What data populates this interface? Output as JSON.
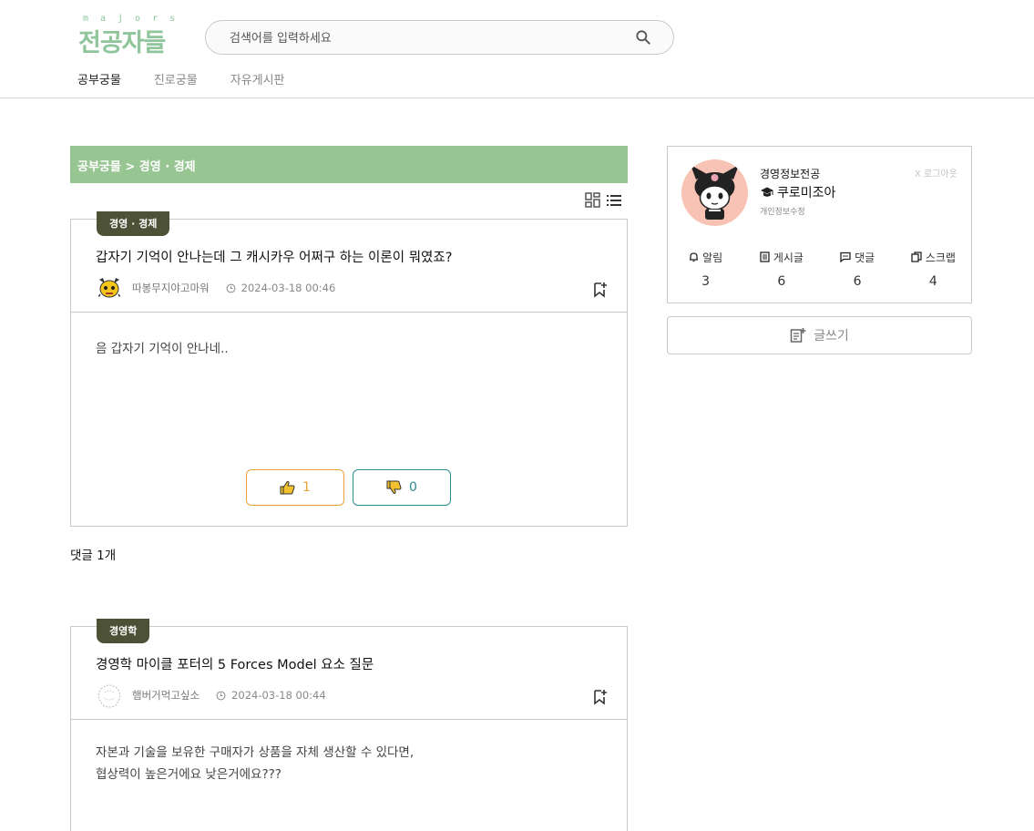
{
  "header": {
    "logo_small": "majors",
    "logo_main": "전공자들",
    "search_placeholder": "검색어를 입력하세요",
    "nav": [
      {
        "label": "공부궁물",
        "active": true
      },
      {
        "label": "진로궁물",
        "active": false
      },
      {
        "label": "자유게시판",
        "active": false
      }
    ]
  },
  "breadcrumb": "공부궁물 > 경영 · 경제",
  "posts": [
    {
      "tag": "경영 · 경제",
      "title": "갑자기 기억이 안나는데 그 캐시카우 어쩌구 하는 이론이 뭐였죠?",
      "author": "따봉무지야고마워",
      "date": "2024-03-18 00:46",
      "body": [
        "음 갑자기 기억이 안나네.."
      ],
      "likes": "1",
      "dislikes": "0"
    },
    {
      "tag": "경영학",
      "title": "경영학 마이클 포터의 5 Forces Model 요소 질문",
      "author": "햄버거먹고싶소",
      "date": "2024-03-18 00:44",
      "body": [
        "자본과 기술을 보유한 구매자가 상품을 자체 생산할 수 있다면,",
        "협상력이 높은거에요 낮은거에요???"
      ]
    }
  ],
  "comment_count": "댓글 1개",
  "profile": {
    "major": "경영정보전공",
    "nickname": "쿠로미조아",
    "edit_label": "개인정보수정",
    "logout_label": "X 로그아웃",
    "stats": [
      {
        "label": "알림",
        "value": "3",
        "icon": "bell-icon"
      },
      {
        "label": "게시글",
        "value": "6",
        "icon": "document-icon"
      },
      {
        "label": "댓글",
        "value": "6",
        "icon": "chat-icon"
      },
      {
        "label": "스크랩",
        "value": "4",
        "icon": "copy-icon"
      }
    ]
  },
  "write_label": "글쓰기",
  "colors": {
    "accent_green": "#98c693",
    "tag_dark": "#4d5236",
    "like": "#e8a23a",
    "dislike": "#2f8a8f"
  }
}
